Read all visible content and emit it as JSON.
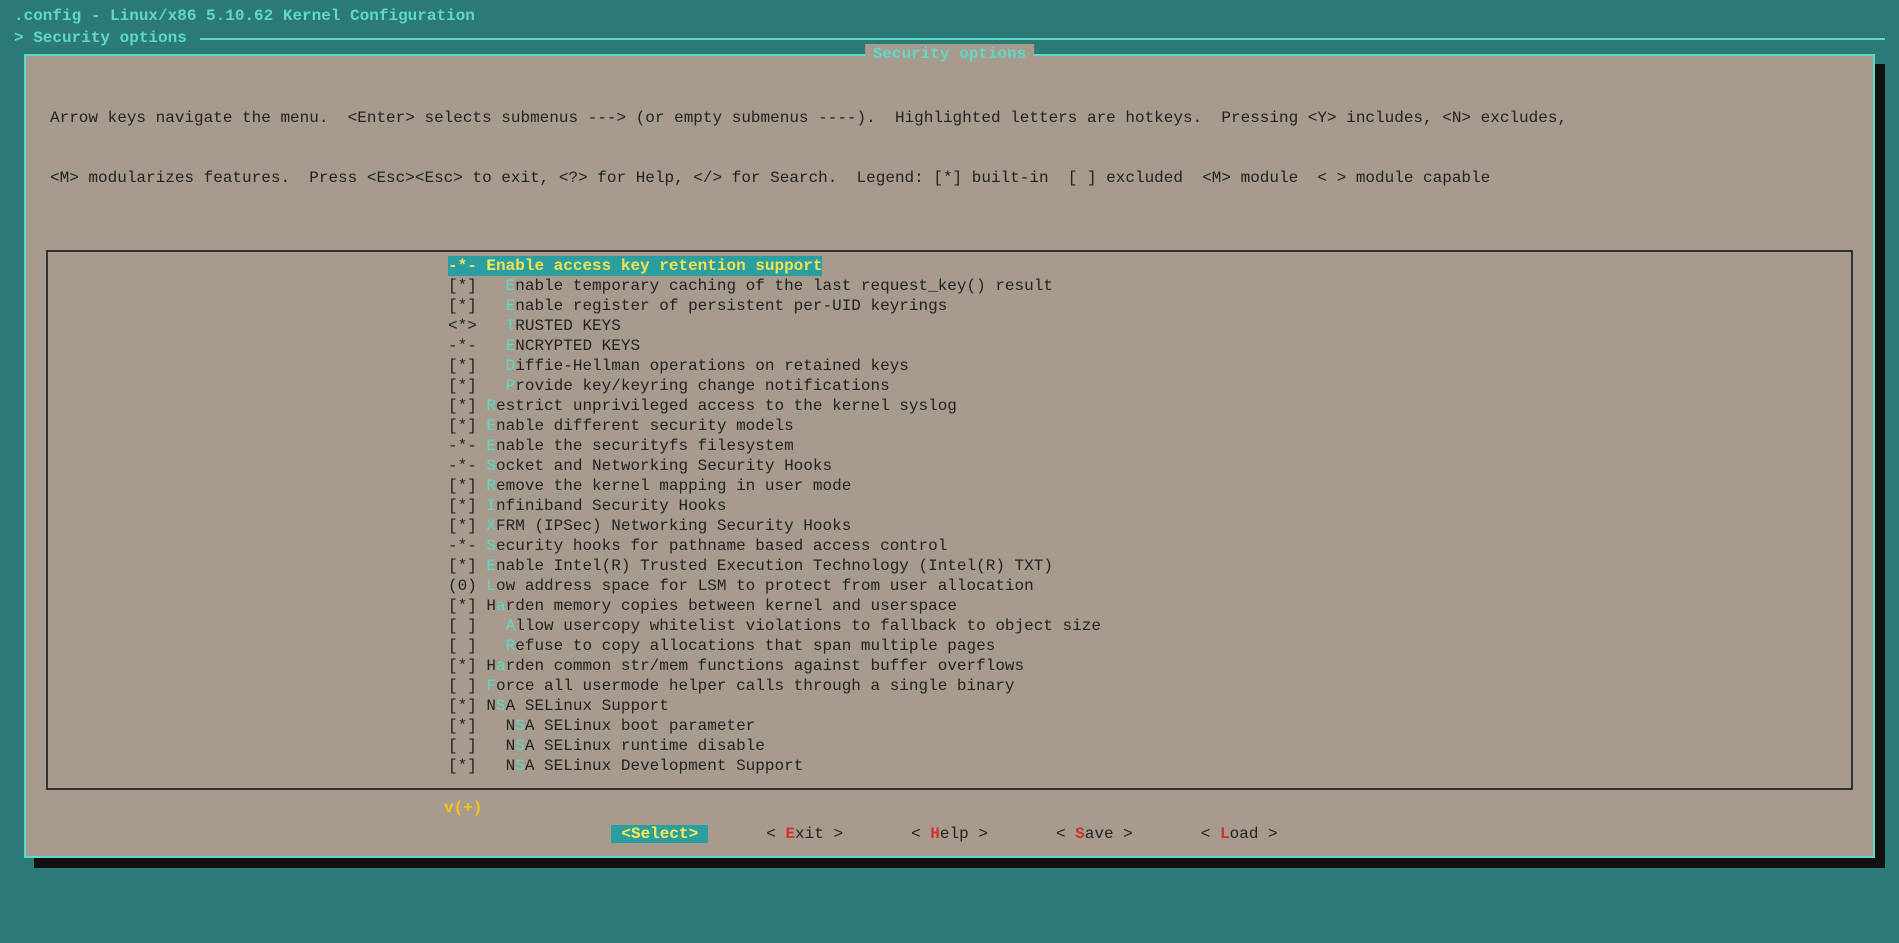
{
  "title": ".config - Linux/x86 5.10.62 Kernel Configuration",
  "breadcrumb_prefix": "> ",
  "breadcrumb": "Security options",
  "panel_title": "Security options",
  "help_line1": "Arrow keys navigate the menu.  <Enter> selects submenus ---> (or empty submenus ----).  Highlighted letters are hotkeys.  Pressing <Y> includes, <N> excludes,",
  "help_line2": "<M> modularizes features.  Press <Esc><Esc> to exit, <?> for Help, </> for Search.  Legend: [*] built-in  [ ] excluded  <M> module  < > module capable",
  "options": [
    {
      "mark": "-*-",
      "indent": 0,
      "hotpos": 0,
      "label": "Enable access key retention support",
      "selected": true
    },
    {
      "mark": "[*]",
      "indent": 1,
      "hotpos": 0,
      "label": "Enable temporary caching of the last request_key() result"
    },
    {
      "mark": "[*]",
      "indent": 1,
      "hotpos": 0,
      "label": "Enable register of persistent per-UID keyrings"
    },
    {
      "mark": "<*>",
      "indent": 1,
      "hotpos": 0,
      "label": "TRUSTED KEYS"
    },
    {
      "mark": "-*-",
      "indent": 1,
      "hotpos": 0,
      "label": "ENCRYPTED KEYS"
    },
    {
      "mark": "[*]",
      "indent": 1,
      "hotpos": 0,
      "label": "Diffie-Hellman operations on retained keys"
    },
    {
      "mark": "[*]",
      "indent": 1,
      "hotpos": 0,
      "label": "Provide key/keyring change notifications"
    },
    {
      "mark": "[*]",
      "indent": 0,
      "hotpos": 0,
      "label": "Restrict unprivileged access to the kernel syslog"
    },
    {
      "mark": "[*]",
      "indent": 0,
      "hotpos": 0,
      "label": "Enable different security models"
    },
    {
      "mark": "-*-",
      "indent": 0,
      "hotpos": 0,
      "label": "Enable the securityfs filesystem"
    },
    {
      "mark": "-*-",
      "indent": 0,
      "hotpos": 0,
      "label": "Socket and Networking Security Hooks"
    },
    {
      "mark": "[*]",
      "indent": 0,
      "hotpos": 0,
      "label": "Remove the kernel mapping in user mode"
    },
    {
      "mark": "[*]",
      "indent": 0,
      "hotpos": 0,
      "label": "Infiniband Security Hooks"
    },
    {
      "mark": "[*]",
      "indent": 0,
      "hotpos": 0,
      "label": "XFRM (IPSec) Networking Security Hooks"
    },
    {
      "mark": "-*-",
      "indent": 0,
      "hotpos": 0,
      "label": "Security hooks for pathname based access control"
    },
    {
      "mark": "[*]",
      "indent": 0,
      "hotpos": 0,
      "label": "Enable Intel(R) Trusted Execution Technology (Intel(R) TXT)"
    },
    {
      "mark": "(0)",
      "indent": 0,
      "hotpos": 0,
      "label": "Low address space for LSM to protect from user allocation"
    },
    {
      "mark": "[*]",
      "indent": 0,
      "hotpos": 1,
      "label": "Harden memory copies between kernel and userspace"
    },
    {
      "mark": "[ ]",
      "indent": 1,
      "hotpos": 0,
      "label": "Allow usercopy whitelist violations to fallback to object size"
    },
    {
      "mark": "[ ]",
      "indent": 1,
      "hotpos": 0,
      "label": "Refuse to copy allocations that span multiple pages"
    },
    {
      "mark": "[*]",
      "indent": 0,
      "hotpos": 1,
      "label": "Harden common str/mem functions against buffer overflows"
    },
    {
      "mark": "[ ]",
      "indent": 0,
      "hotpos": 0,
      "label": "Force all usermode helper calls through a single binary"
    },
    {
      "mark": "[*]",
      "indent": 0,
      "hotpos": 1,
      "label": "NSA SELinux Support"
    },
    {
      "mark": "[*]",
      "indent": 1,
      "hotpos": 1,
      "label": "NSA SELinux boot parameter"
    },
    {
      "mark": "[ ]",
      "indent": 1,
      "hotpos": 1,
      "label": "NSA SELinux runtime disable"
    },
    {
      "mark": "[*]",
      "indent": 1,
      "hotpos": 1,
      "label": "NSA SELinux Development Support"
    }
  ],
  "scroll_indicator": "v(+)",
  "buttons": [
    {
      "pre": "S",
      "label": "elect",
      "active": true
    },
    {
      "pre": "E",
      "label": "xit"
    },
    {
      "pre": "H",
      "label": "elp"
    },
    {
      "pre": "S",
      "label": "ave"
    },
    {
      "pre": "L",
      "label": "oad"
    }
  ]
}
